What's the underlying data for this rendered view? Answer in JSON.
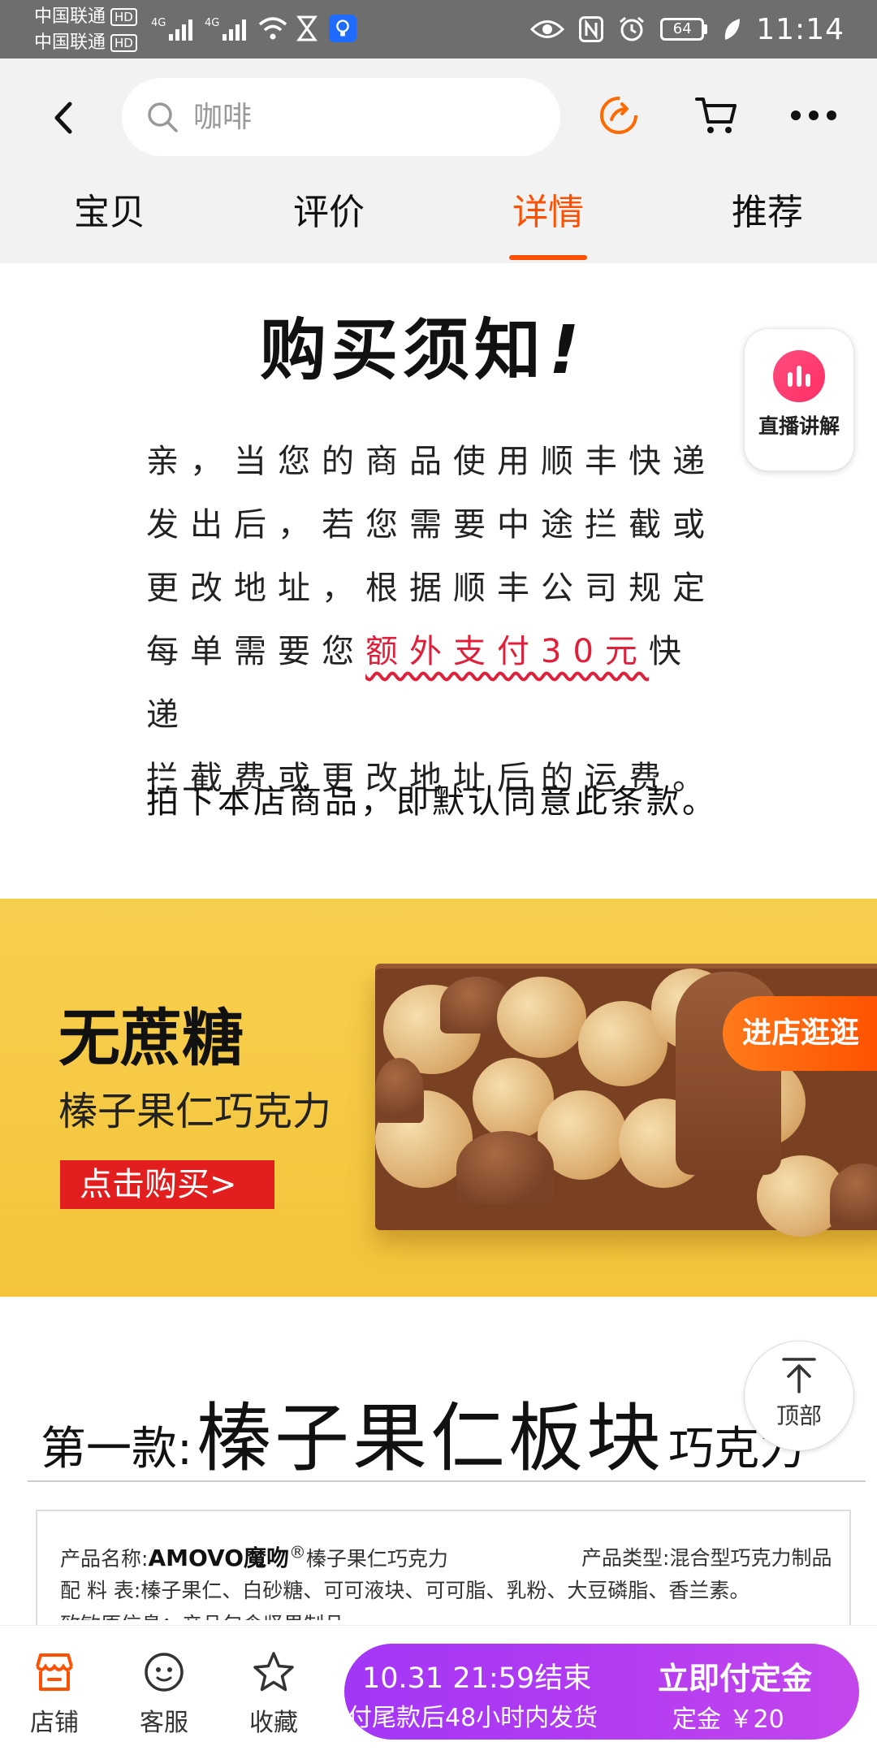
{
  "status_bar": {
    "carrier1": "中国联通",
    "carrier2": "中国联通",
    "hd": "HD",
    "net1": "4G",
    "net2": "4G",
    "battery": "64",
    "time": "11:14"
  },
  "header": {
    "search_placeholder": "咖啡",
    "tabs": [
      "宝贝",
      "评价",
      "详情",
      "推荐"
    ],
    "active_tab": "详情"
  },
  "notice": {
    "title": "购买须知",
    "title_mark": "!",
    "line1": "亲，当您的商品使用顺丰快递",
    "line2": "发出后，若您需要中途拦截或",
    "line3": "更改地址，根据顺丰公司规定",
    "line4_a": "每单需要您",
    "line4_hl": "额外支付30元",
    "line4_b": "快递",
    "line5": "拦截费或更改地址后的运费。",
    "footer": "拍下本店商品，即默认同意此条款。"
  },
  "live_badge": {
    "label": "直播讲解"
  },
  "banner": {
    "title": "无蔗糖",
    "subtitle": "榛子果仁巧克力",
    "button": "点击购买>"
  },
  "store_button": "进店逛逛",
  "product": {
    "prefix": "第一款:",
    "name": "榛子果仁板块",
    "tail": "巧克力",
    "spec_name_label": "产品名称:",
    "spec_brand": "AMOVO魔吻",
    "spec_reg": "®",
    "spec_name_value": "榛子果仁巧克力",
    "spec_type_label": "产品类型:",
    "spec_type_value": "混合型巧克力制品",
    "spec_ing_label": "配    料    表:",
    "spec_ing_value": "榛子果仁、白砂糖、可可液块、可可脂、乳粉、大豆磷脂、香兰素。",
    "spec_partial": "致敏原信息：产品包含坚果制品"
  },
  "top_button": "顶部",
  "bottom_bar": {
    "shop": "店铺",
    "service": "客服",
    "favorite": "收藏",
    "buy_line1": "10.31 21:59结束",
    "buy_line2": "付尾款后48小时内发货",
    "buy_action": "立即付定金",
    "deposit": "定金 ￥20"
  },
  "colors": {
    "accent": "#ff5000",
    "highlight_red": "#e0203a",
    "banner_yellow": "#f6c942",
    "buy_purple": "#b03af3"
  },
  "icons": [
    "back-icon",
    "search-icon",
    "share-icon",
    "cart-icon",
    "more-icon",
    "live-icon",
    "arrow-up-icon",
    "shop-icon",
    "service-icon",
    "star-icon"
  ]
}
